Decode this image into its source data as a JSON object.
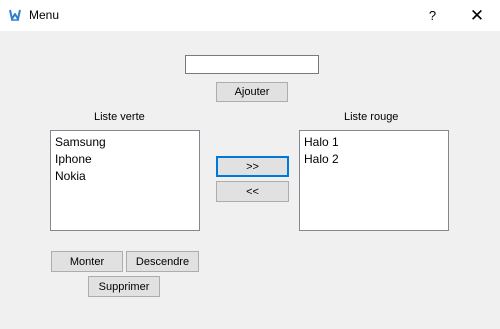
{
  "window": {
    "title": "Menu",
    "help_label": "?",
    "close_label": "✕",
    "icon": "app-logo-icon"
  },
  "entry": {
    "value": "",
    "placeholder": ""
  },
  "buttons": {
    "add": "Ajouter",
    "move_right": ">>",
    "move_left": "<<",
    "up": "Monter",
    "down": "Descendre",
    "delete": "Supprimer"
  },
  "green_list": {
    "label": "Liste verte",
    "items": [
      "Samsung",
      "Iphone",
      "Nokia"
    ]
  },
  "red_list": {
    "label": "Liste rouge",
    "items": [
      "Halo 1",
      "Halo 2"
    ]
  },
  "colors": {
    "accent": "#0078d7",
    "icon": "#2f7fcf"
  }
}
